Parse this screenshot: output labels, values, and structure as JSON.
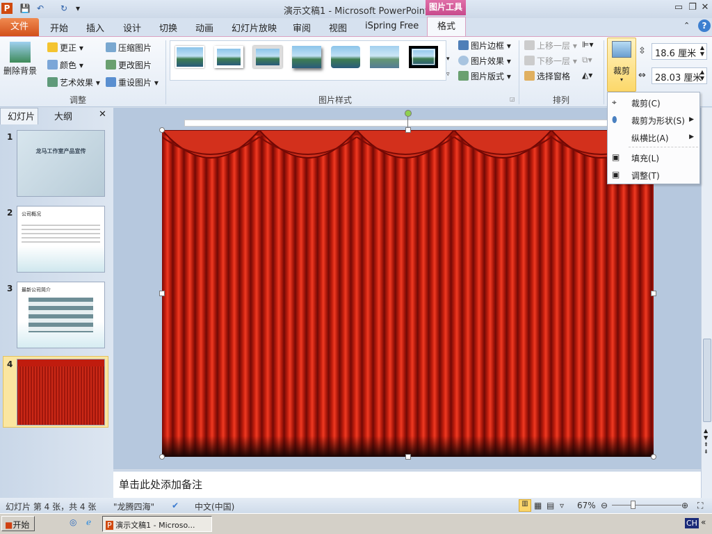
{
  "window": {
    "title": "演示文稿1 - Microsoft PowerPoint",
    "context_header": "图片工具"
  },
  "tabs": [
    "文件",
    "开始",
    "插入",
    "设计",
    "切换",
    "动画",
    "幻灯片放映",
    "审阅",
    "视图",
    "iSpring Free",
    "格式"
  ],
  "ribbon": {
    "adjust": {
      "remove_bg": "删除背景",
      "corrections": "更正",
      "color": "颜色",
      "artistic": "艺术效果",
      "compress": "压缩图片",
      "change": "更改图片",
      "reset": "重设图片",
      "group": "调整"
    },
    "styles": {
      "border": "图片边框",
      "effects": "图片效果",
      "layout": "图片版式",
      "group": "图片样式"
    },
    "arrange": {
      "forward": "上移一层",
      "backward": "下移一层",
      "pane": "选择窗格",
      "group": "排列"
    },
    "size": {
      "crop": "裁剪",
      "height": "18.6 厘米",
      "width": "28.03 厘米"
    }
  },
  "crop_menu": [
    "裁剪(C)",
    "裁剪为形状(S)",
    "纵横比(A)",
    "填充(L)",
    "调整(T)"
  ],
  "pane": {
    "tab_slides": "幻灯片",
    "tab_outline": "大纲",
    "close": "✕",
    "slides": [
      {
        "num": "1",
        "title": "龙马工作室产品宣传"
      },
      {
        "num": "2",
        "title": "公司概况"
      },
      {
        "num": "3",
        "title": "最新公司简介"
      },
      {
        "num": "4",
        "title": ""
      }
    ]
  },
  "notes_placeholder": "单击此处添加备注",
  "status": {
    "slide": "幻灯片 第 4 张，共 4 张",
    "theme": "\"龙腾四海\"",
    "lang": "中文(中国)",
    "zoom": "67%"
  },
  "taskbar": {
    "start": "开始",
    "task": "演示文稿1 - Microso...",
    "ime": "CH"
  }
}
